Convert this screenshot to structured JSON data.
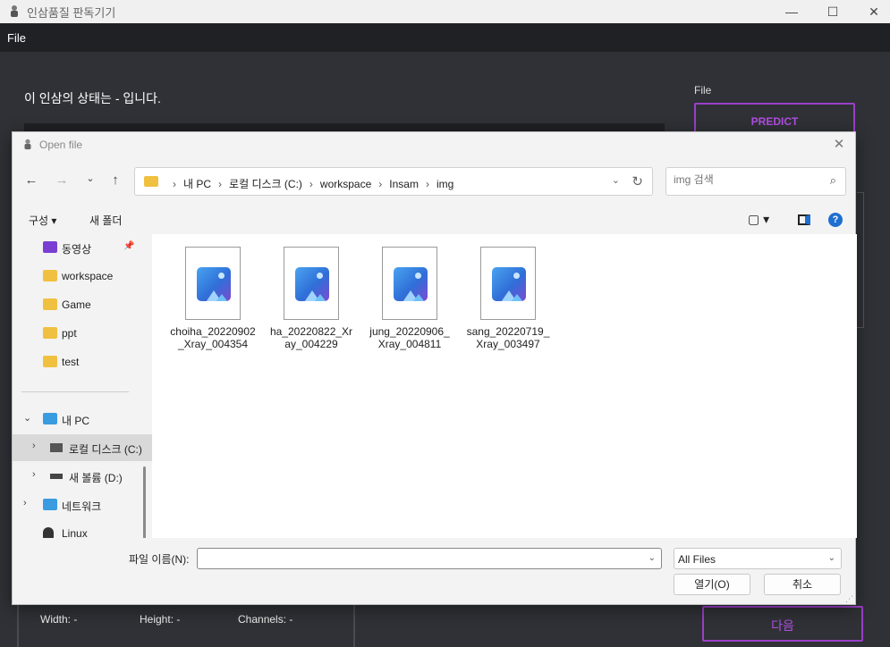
{
  "window": {
    "title": "인삼품질 판독기기",
    "menu_file": "File",
    "minimize": "—",
    "maximize": "☐",
    "close": "✕"
  },
  "main": {
    "status_text": "이 인삼의 상태는 - 입니다.",
    "file_label": "File",
    "predict_button": "PREDICT",
    "width_label": "Width: -",
    "height_label": "Height: -",
    "channels_label": "Channels: -",
    "next_button": "다음"
  },
  "dialog": {
    "title": "Open file",
    "close": "✕",
    "breadcrumbs": [
      "내 PC",
      "로컬 디스크 (C:)",
      "workspace",
      "Insam",
      "img"
    ],
    "search_placeholder": "img 검색",
    "organize": "구성 ▾",
    "new_folder": "새 폴더",
    "help": "?",
    "nav_items": [
      {
        "label": "동영상",
        "icon": "video-folder-icon"
      },
      {
        "label": "workspace",
        "icon": "folder-icon"
      },
      {
        "label": "Game",
        "icon": "folder-icon"
      },
      {
        "label": "ppt",
        "icon": "folder-icon"
      },
      {
        "label": "test",
        "icon": "folder-icon"
      }
    ],
    "tree": [
      {
        "label": "내 PC",
        "chevron": "⌄"
      },
      {
        "label": "로컬 디스크 (C:)",
        "chevron": "›"
      },
      {
        "label": "새 볼륨 (D:)",
        "chevron": "›"
      },
      {
        "label": "네트워크",
        "chevron": "›"
      },
      {
        "label": "Linux",
        "chevron": ""
      }
    ],
    "files": [
      "choiha_20220902_Xray_004354",
      "ha_20220822_Xray_004229",
      "jung_20220906_Xray_004811",
      "sang_20220719_Xray_003497"
    ],
    "filename_label": "파일 이름(N):",
    "filename_value": "",
    "filetype": "All Files",
    "open_button": "열기(O)",
    "cancel_button": "취소"
  },
  "colors": {
    "accent_purple": "#9b3fc8",
    "app_background": "#2f3136",
    "menubar": "#202124"
  }
}
